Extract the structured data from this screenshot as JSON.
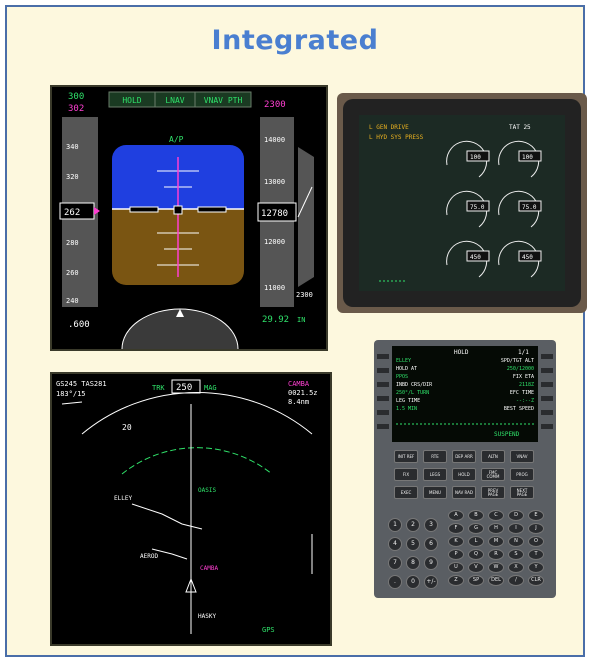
{
  "slide": {
    "title": "Integrated"
  },
  "pfd": {
    "fma": [
      "HOLD",
      "LNAV",
      "VNAV PTH"
    ],
    "speed_top": "300",
    "speed_bug": "302",
    "speed_current": "262",
    "speed_ticks": [
      "340",
      "320",
      "280",
      "260",
      "240"
    ],
    "ap_status": "A/P",
    "altitude_target": "2300",
    "altitude_ticks": [
      "14000",
      "13000",
      "12000",
      "11000"
    ],
    "altitude_current": "12780",
    "vs_readout": "2300",
    "mach": ".600",
    "baro": "29.92",
    "baro_unit": "IN"
  },
  "eicas": {
    "messages": [
      "L GEN DRIVE",
      "L HYD SYS PRESS"
    ],
    "header_right": "TAT 25",
    "gauge_values": [
      "100",
      "100",
      "75.0",
      "75.0",
      "450",
      "450"
    ]
  },
  "nd": {
    "header_left": "GS245 TAS281",
    "wind": "183°/15",
    "heading_mode": "TRK",
    "heading_value": "250",
    "heading_ref": "MAG",
    "wpt_name": "CAMBA",
    "wpt_time": "0021.5z",
    "wpt_dist": "8.4nm",
    "waypoints": [
      "CAMBA",
      "OASIS",
      "ELLEY",
      "AEROD",
      "HASKY"
    ],
    "range_label": "20",
    "mode_label": "GPS"
  },
  "cdu": {
    "title": "HOLD",
    "page": "1/1",
    "left_lines": [
      "ELLEY",
      "HOLD AT",
      "PPOS",
      "INBD CRS/DIR",
      "250°/L TURN",
      "LEG TIME",
      "1.5 MIN"
    ],
    "right_lines": [
      "SPD/TGT ALT",
      "250/12000",
      "FIX ETA",
      "2118Z",
      "EFC TIME",
      "--:--Z",
      "BEST SPEED"
    ],
    "footer": "SUSPEND",
    "function_keys": [
      "INIT REF",
      "RTE",
      "DEP ARR",
      "ALTN",
      "VNAV",
      "FIX",
      "LEGS",
      "HOLD",
      "FMC COMM",
      "PROG",
      "EXEC",
      "MENU",
      "NAV RAD",
      "PREV PAGE",
      "NEXT PAGE"
    ],
    "alpha_keys": [
      "A",
      "B",
      "C",
      "D",
      "E",
      "F",
      "G",
      "H",
      "I",
      "J",
      "K",
      "L",
      "M",
      "N",
      "O",
      "P",
      "Q",
      "R",
      "S",
      "T",
      "U",
      "V",
      "W",
      "X",
      "Y",
      "Z",
      "SP",
      "DEL",
      "/",
      "CLR"
    ],
    "num_keys": [
      "1",
      "2",
      "3",
      "4",
      "5",
      "6",
      "7",
      "8",
      "9",
      ".",
      "0",
      "+/-"
    ]
  },
  "colors": {
    "frame_bg": "#fdf8de",
    "frame_border": "#4a6ea8",
    "title": "#4a7fd0",
    "sky": "#1f3fe0",
    "ground": "#7a5512",
    "display_green": "#2fe26a",
    "display_magenta": "#ff3fd2",
    "cdu_bezel": "#5a5e63"
  }
}
